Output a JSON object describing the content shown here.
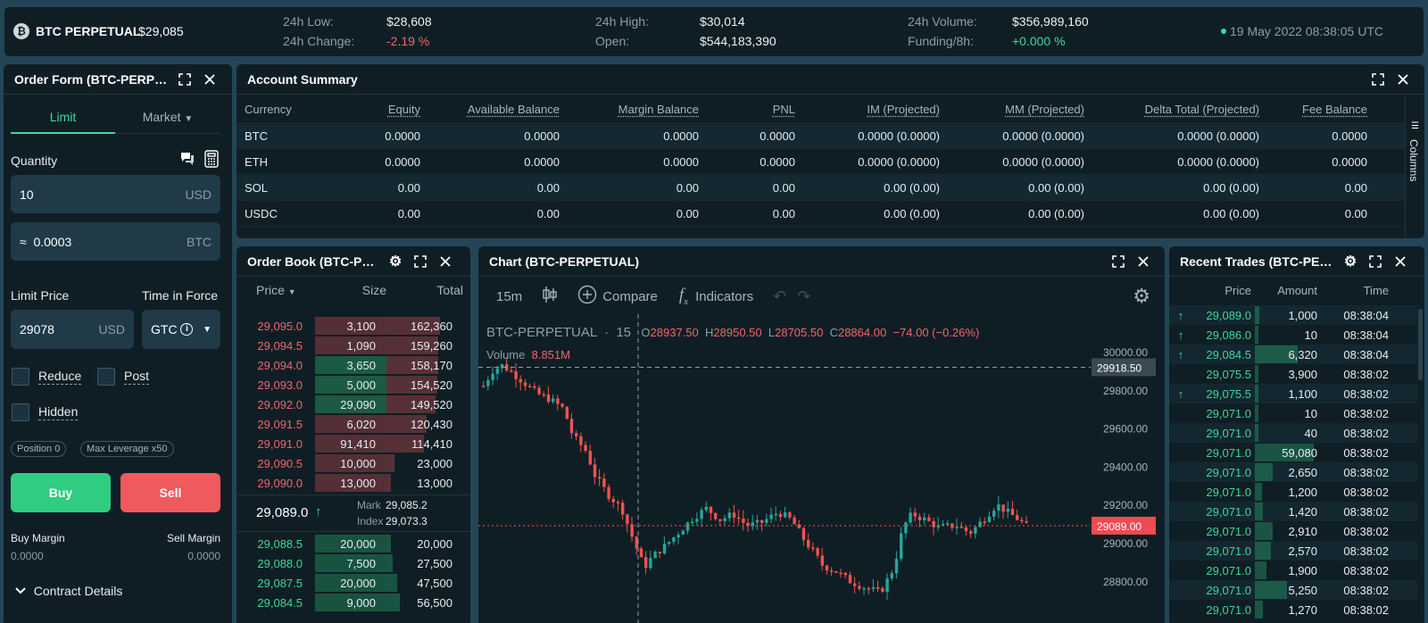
{
  "ticker": {
    "instrument": "BTC PERPETUAL",
    "price": "$29,085",
    "low_label": "24h Low:",
    "low_value": "$28,608",
    "change_label": "24h Change:",
    "change_value": "-2.19 %",
    "high_label": "24h High:",
    "high_value": "$30,014",
    "open_label": "Open:",
    "open_value": "$544,183,390",
    "volume_label": "24h Volume:",
    "volume_value": "$356,989,160",
    "funding_label": "Funding/8h:",
    "funding_value": "+0.000 %",
    "datetime": "19 May 2022 08:38:05 UTC"
  },
  "order_form": {
    "title": "Order Form (BTC-PERPETUAL)",
    "tab_limit": "Limit",
    "tab_market": "Market",
    "quantity_label": "Quantity",
    "quantity_value": "10",
    "quantity_unit": "USD",
    "approx_symbol": "≈",
    "approx_value": "0.0003",
    "approx_unit": "BTC",
    "limit_price_label": "Limit Price",
    "time_in_force_label": "Time in Force",
    "limit_price_value": "29078",
    "limit_price_unit": "USD",
    "tif_value": "GTC",
    "reduce_label": "Reduce",
    "post_label": "Post",
    "hidden_label": "Hidden",
    "position_chip": "Position 0",
    "leverage_chip": "Max Leverage x50",
    "buy_label": "Buy",
    "sell_label": "Sell",
    "buy_margin_label": "Buy Margin",
    "buy_margin_value": "0.0000",
    "sell_margin_label": "Sell Margin",
    "sell_margin_value": "0.0000",
    "contract_details_label": "Contract Details"
  },
  "account": {
    "title": "Account Summary",
    "columns_label": "Columns",
    "headers": [
      "Currency",
      "Equity",
      "Available Balance",
      "Margin Balance",
      "PNL",
      "IM (Projected)",
      "MM (Projected)",
      "Delta Total (Projected)",
      "Fee Balance"
    ],
    "rows": [
      [
        "BTC",
        "0.0000",
        "0.0000",
        "0.0000",
        "0.0000",
        "0.0000 (0.0000)",
        "0.0000 (0.0000)",
        "0.0000 (0.0000)",
        "0.0000"
      ],
      [
        "ETH",
        "0.0000",
        "0.0000",
        "0.0000",
        "0.0000",
        "0.0000 (0.0000)",
        "0.0000 (0.0000)",
        "0.0000 (0.0000)",
        "0.0000"
      ],
      [
        "SOL",
        "0.00",
        "0.00",
        "0.00",
        "0.00",
        "0.00 (0.00)",
        "0.00 (0.00)",
        "0.00 (0.00)",
        "0.00"
      ],
      [
        "USDC",
        "0.00",
        "0.00",
        "0.00",
        "0.00",
        "0.00 (0.00)",
        "0.00 (0.00)",
        "0.00 (0.00)",
        "0.00"
      ]
    ]
  },
  "order_book": {
    "title": "Order Book (BTC-PERPETUAL)",
    "col_price": "Price",
    "col_size": "Size",
    "col_total": "Total",
    "asks": [
      {
        "price": "29,095.0",
        "size": "3,100",
        "total": "162,360",
        "depth": 0.7
      },
      {
        "price": "29,094.5",
        "size": "1,090",
        "total": "159,260",
        "depth": 0.68
      },
      {
        "price": "29,094.0",
        "size": "3,650",
        "total": "158,170",
        "depth": 0.67
      },
      {
        "price": "29,093.0",
        "size": "5,000",
        "total": "154,520",
        "depth": 0.66
      },
      {
        "price": "29,092.0",
        "size": "29,090",
        "total": "149,520",
        "depth": 0.64
      },
      {
        "price": "29,091.5",
        "size": "6,020",
        "total": "120,430",
        "depth": 0.52
      },
      {
        "price": "29,091.0",
        "size": "91,410",
        "total": "114,410",
        "depth": 0.49
      },
      {
        "price": "29,090.5",
        "size": "10,000",
        "total": "23,000",
        "depth": 0.1
      },
      {
        "price": "29,090.0",
        "size": "13,000",
        "total": "13,000",
        "depth": 0.06
      }
    ],
    "last_price": "29,089.0",
    "mark_label": "Mark",
    "mark_value": "29,085.2",
    "index_label": "Index",
    "index_value": "29,073.3",
    "bids": [
      {
        "price": "29,088.5",
        "size": "20,000",
        "total": "20,000",
        "depth": 0.06
      },
      {
        "price": "29,088.0",
        "size": "7,500",
        "total": "27,500",
        "depth": 0.08
      },
      {
        "price": "29,087.5",
        "size": "20,000",
        "total": "47,500",
        "depth": 0.14
      },
      {
        "price": "29,084.5",
        "size": "9,000",
        "total": "56,500",
        "depth": 0.17
      }
    ]
  },
  "chart": {
    "title": "Chart (BTC-PERPETUAL)",
    "interval": "15m",
    "compare": "Compare",
    "indicators": "Indicators",
    "symbol": "BTC-PERPETUAL",
    "period": "15",
    "o_label": "O",
    "o_value": "28937.50",
    "h_label": "H",
    "h_value": "28950.50",
    "l_label": "L",
    "l_value": "28705.50",
    "c_label": "C",
    "c_value": "28864.00",
    "change": "−74.00 (−0.26%)",
    "volume_label": "Volume",
    "volume_value": "8.851M",
    "crosshair_price": "29918.50",
    "last_price_label": "29089.00",
    "y_ticks": [
      "30000.00",
      "29800.00",
      "29600.00",
      "29400.00",
      "29200.00",
      "29000.00",
      "28800.00"
    ],
    "chart_data": {
      "type": "candlestick",
      "ylim": [
        28700,
        30050
      ],
      "y_ticks": [
        30000,
        29800,
        29600,
        29400,
        29200,
        29000,
        28800
      ],
      "last_price": 29089,
      "crosshair_price": 29918.5
    }
  },
  "trades": {
    "title": "Recent Trades (BTC-PERPETUAL)",
    "col_price": "Price",
    "col_amount": "Amount",
    "col_time": "Time",
    "rows": [
      {
        "price": "29,089.0",
        "amount": "1,000",
        "time": "08:38:04",
        "up": true,
        "depth": 0.08
      },
      {
        "price": "29,086.0",
        "amount": "10",
        "time": "08:38:04",
        "up": true,
        "depth": 0.03
      },
      {
        "price": "29,084.5",
        "amount": "6,320",
        "time": "08:38:04",
        "up": true,
        "depth": 0.72
      },
      {
        "price": "29,075.5",
        "amount": "3,900",
        "time": "08:38:02",
        "up": false,
        "depth": 0.05
      },
      {
        "price": "29,075.5",
        "amount": "1,100",
        "time": "08:38:02",
        "up": true,
        "depth": 0.06
      },
      {
        "price": "29,071.0",
        "amount": "10",
        "time": "08:38:02",
        "up": false,
        "depth": 0.03
      },
      {
        "price": "29,071.0",
        "amount": "40",
        "time": "08:38:02",
        "up": false,
        "depth": 0.03
      },
      {
        "price": "29,071.0",
        "amount": "59,080",
        "time": "08:38:02",
        "up": false,
        "depth": 1.0
      },
      {
        "price": "29,071.0",
        "amount": "2,650",
        "time": "08:38:02",
        "up": false,
        "depth": 0.3
      },
      {
        "price": "29,071.0",
        "amount": "1,200",
        "time": "08:38:02",
        "up": false,
        "depth": 0.12
      },
      {
        "price": "29,071.0",
        "amount": "1,420",
        "time": "08:38:02",
        "up": false,
        "depth": 0.14
      },
      {
        "price": "29,071.0",
        "amount": "2,910",
        "time": "08:38:02",
        "up": false,
        "depth": 0.3
      },
      {
        "price": "29,071.0",
        "amount": "2,570",
        "time": "08:38:02",
        "up": false,
        "depth": 0.27
      },
      {
        "price": "29,071.0",
        "amount": "1,900",
        "time": "08:38:02",
        "up": false,
        "depth": 0.2
      },
      {
        "price": "29,071.0",
        "amount": "5,250",
        "time": "08:38:02",
        "up": false,
        "depth": 0.55
      },
      {
        "price": "29,071.0",
        "amount": "1,270",
        "time": "08:38:02",
        "up": false,
        "depth": 0.13
      }
    ]
  },
  "colors": {
    "green": "#3ed89a",
    "red": "#f0656a",
    "buy": "#2fcc82",
    "sell": "#ef5a5f",
    "accent": "#3ed89a",
    "panel": "#0f1e25",
    "bg": "#234556"
  }
}
